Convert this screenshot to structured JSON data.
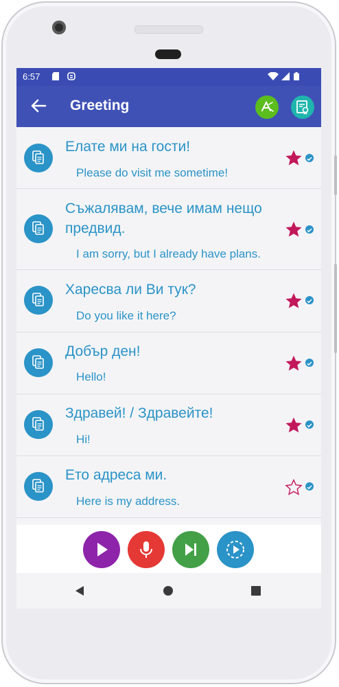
{
  "status_bar": {
    "time": "6:57"
  },
  "app_bar": {
    "title": "Greeting"
  },
  "phrases": [
    {
      "bg": "Елате ми на гости!",
      "en": "Please do visit me sometime!",
      "favorite": true
    },
    {
      "bg": "Съжалявам, вече имам нещо предвид.",
      "en": "I am sorry, but I already have plans.",
      "favorite": true
    },
    {
      "bg": "Харесва ли Ви тук?",
      "en": "Do you like it here?",
      "favorite": true
    },
    {
      "bg": "Добър ден!",
      "en": "Hello!",
      "favorite": true
    },
    {
      "bg": "Здравей! / Здравейте!",
      "en": "Hi!",
      "favorite": true
    },
    {
      "bg": "Ето адреса ми.",
      "en": "Here is my address.",
      "favorite": false
    }
  ],
  "colors": {
    "app_bar": "#3f51b5",
    "status_bar": "#3a4cb3",
    "accent_text": "#2a93c7",
    "star": "#c2185b",
    "play": "#8e24aa",
    "mic": "#e53935",
    "next": "#43a047",
    "autoplay": "#2a93c7",
    "green_badge": "#5bbd1e",
    "teal_badge": "#1fb5ad"
  },
  "icons": {
    "back": "arrow-left-icon",
    "translate": "translate-icon",
    "certificate": "certificate-icon",
    "copy": "copy-icon",
    "star": "star-icon",
    "play": "play-icon",
    "mic": "microphone-icon",
    "next": "skip-next-icon",
    "autoplay": "autoplay-icon"
  }
}
